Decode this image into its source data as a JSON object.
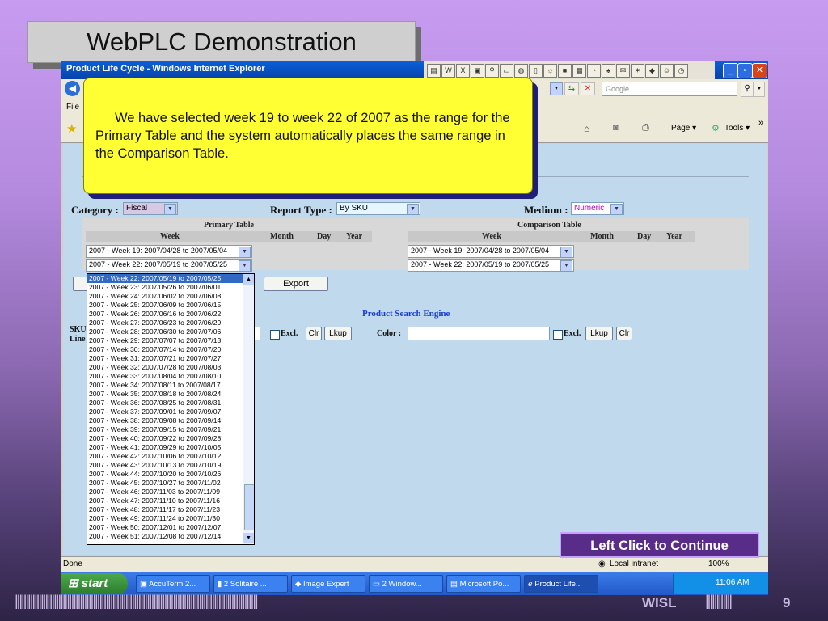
{
  "slide": {
    "title": "WebPLC Demonstration",
    "callout": "We have selected week 19 to week 22 of 2007 as the range for the Primary Table and the system automatically places the same range in the Comparison Table.",
    "continue_label": "Left Click to Continue",
    "brand": "WISL",
    "page_number": "9",
    "bars_left": "||||||||||||||||||||||||||||||||||||||||||||||||||||||||||||||||||||||||||||||||||||||||||||||||||||||||||||||||",
    "bars_right": "||||||||||||"
  },
  "browser": {
    "title": "Product Life Cycle - Windows Internet Explorer",
    "search_placeholder": "Google",
    "menu_file": "File",
    "page_btn": "Page",
    "tools_btn": "Tools",
    "status_text": "Done",
    "zone": "Local intranet",
    "zoom": "100%"
  },
  "form": {
    "category_label": "Category :",
    "category_value": "Fiscal",
    "report_type_label": "Report Type :",
    "report_type_value": "By SKU",
    "medium_label": "Medium :",
    "medium_value": "Numeric",
    "primary_table": "Primary Table",
    "comparison_table": "Comparison Table",
    "col_week": "Week",
    "col_month": "Month",
    "col_day": "Day",
    "col_year": "Year",
    "primary_from": "2007 - Week 19: 2007/04/28 to 2007/05/04",
    "primary_to": "2007 - Week 22: 2007/05/19 to 2007/05/25",
    "comparison_from": "2007 - Week 19: 2007/04/28 to 2007/05/04",
    "comparison_to": "2007 - Week 22: 2007/05/19 to 2007/05/25",
    "export_label": "Export",
    "search_engine": "Product Search Engine",
    "sku_label": "SKU",
    "line_label": "Line",
    "excl_label": "Excl.",
    "clr_label": "Clr",
    "lkup_label": "Lkup",
    "color_label": "Color :"
  },
  "week_options": [
    "2007 - Week 22: 2007/05/19 to 2007/05/25",
    "2007 - Week 23: 2007/05/26 to 2007/06/01",
    "2007 - Week 24: 2007/06/02 to 2007/06/08",
    "2007 - Week 25: 2007/06/09 to 2007/06/15",
    "2007 - Week 26: 2007/06/16 to 2007/06/22",
    "2007 - Week 27: 2007/06/23 to 2007/06/29",
    "2007 - Week 28: 2007/06/30 to 2007/07/06",
    "2007 - Week 29: 2007/07/07 to 2007/07/13",
    "2007 - Week 30: 2007/07/14 to 2007/07/20",
    "2007 - Week 31: 2007/07/21 to 2007/07/27",
    "2007 - Week 32: 2007/07/28 to 2007/08/03",
    "2007 - Week 33: 2007/08/04 to 2007/08/10",
    "2007 - Week 34: 2007/08/11 to 2007/08/17",
    "2007 - Week 35: 2007/08/18 to 2007/08/24",
    "2007 - Week 36: 2007/08/25 to 2007/08/31",
    "2007 - Week 37: 2007/09/01 to 2007/09/07",
    "2007 - Week 38: 2007/09/08 to 2007/09/14",
    "2007 - Week 39: 2007/09/15 to 2007/09/21",
    "2007 - Week 40: 2007/09/22 to 2007/09/28",
    "2007 - Week 41: 2007/09/29 to 2007/10/05",
    "2007 - Week 42: 2007/10/06 to 2007/10/12",
    "2007 - Week 43: 2007/10/13 to 2007/10/19",
    "2007 - Week 44: 2007/10/20 to 2007/10/26",
    "2007 - Week 45: 2007/10/27 to 2007/11/02",
    "2007 - Week 46: 2007/11/03 to 2007/11/09",
    "2007 - Week 47: 2007/11/10 to 2007/11/16",
    "2007 - Week 48: 2007/11/17 to 2007/11/23",
    "2007 - Week 49: 2007/11/24 to 2007/11/30",
    "2007 - Week 50: 2007/12/01 to 2007/12/07",
    "2007 - Week 51: 2007/12/08 to 2007/12/14"
  ],
  "taskbar": {
    "start": "start",
    "items": [
      "AccuTerm 2...",
      "2 Solitaire ...",
      "Image Expert",
      "2 Window...",
      "Microsoft Po...",
      "Product Life..."
    ],
    "clock": "11:06 AM"
  }
}
